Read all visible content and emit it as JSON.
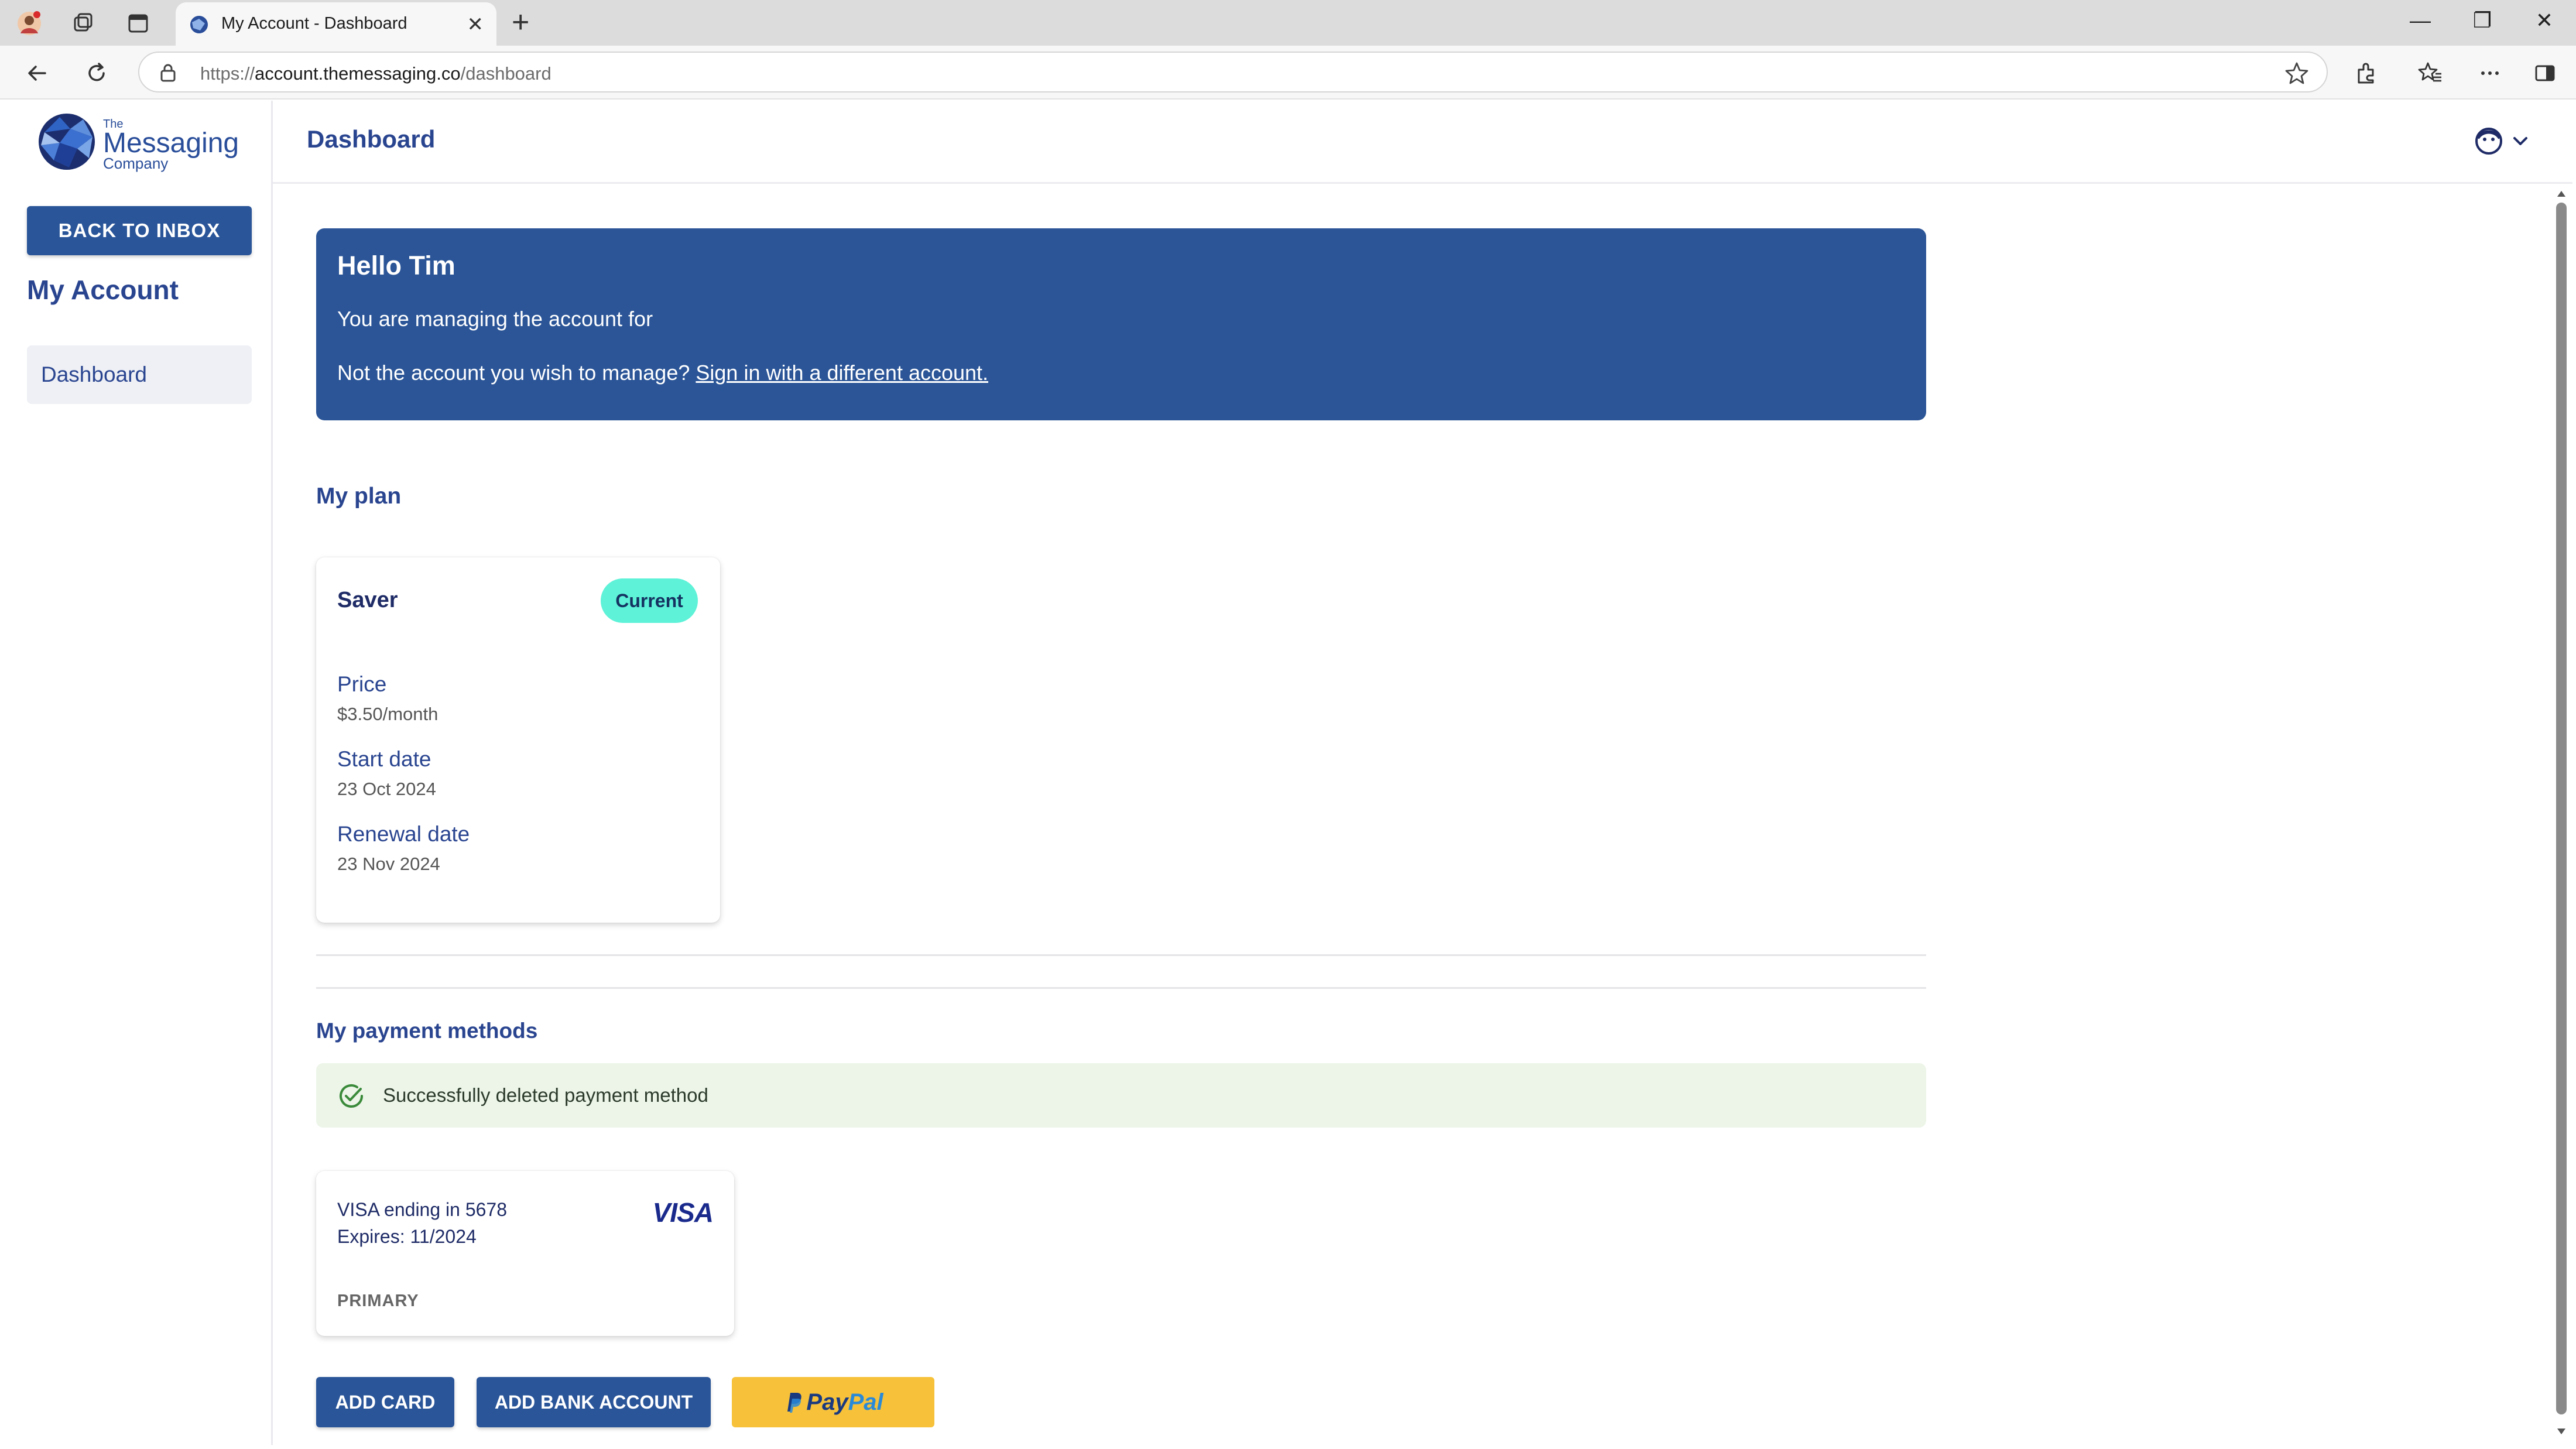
{
  "browser": {
    "tab_title": "My Account - Dashboard",
    "url_prefix": "https://",
    "url_host": "account.themessaging.co",
    "url_path": "/dashboard"
  },
  "sidebar": {
    "logo_the": "The",
    "logo_main": "Messaging",
    "logo_company": "Company",
    "back_button": "BACK TO INBOX",
    "heading": "My Account",
    "items": [
      {
        "label": "Dashboard",
        "active": true
      }
    ]
  },
  "header": {
    "title": "Dashboard"
  },
  "greeting": {
    "title": "Hello Tim",
    "line1": "You are managing the account for",
    "line2_prefix": "Not the account you wish to manage?",
    "line2_link": "Sign in with a different account."
  },
  "plan": {
    "heading": "My plan",
    "name": "Saver",
    "badge": "Current",
    "price_label": "Price",
    "price_value": "$3.50/month",
    "start_label": "Start date",
    "start_value": "23 Oct 2024",
    "renewal_label": "Renewal date",
    "renewal_value": "23 Nov 2024"
  },
  "payments": {
    "heading": "My payment methods",
    "alert": "Successfully deleted payment method",
    "card_title": "VISA ending in 5678",
    "card_expiry": "Expires: 11/2024",
    "card_brand": "VISA",
    "card_tag": "PRIMARY",
    "add_card": "ADD CARD",
    "add_bank": "ADD BANK ACCOUNT",
    "paypal_a": "Pay",
    "paypal_b": "Pal"
  },
  "colors": {
    "brand_blue": "#2a5599",
    "badge_teal": "#5ef2d8",
    "success_bg": "#ecf5e8",
    "paypal_yellow": "#f7c23a"
  },
  "icons": [
    "profile-icon",
    "workspaces-icon",
    "tab-actions-icon",
    "globe-favicon-icon",
    "close-icon",
    "plus-icon",
    "minimize-icon",
    "restore-icon",
    "window-close-icon",
    "back-arrow-icon",
    "refresh-icon",
    "lock-icon",
    "star-icon",
    "extensions-icon",
    "favorites-icon",
    "more-icon",
    "sidebar-toggle-icon",
    "user-avatar-icon",
    "chevron-down-icon",
    "check-circle-icon"
  ]
}
